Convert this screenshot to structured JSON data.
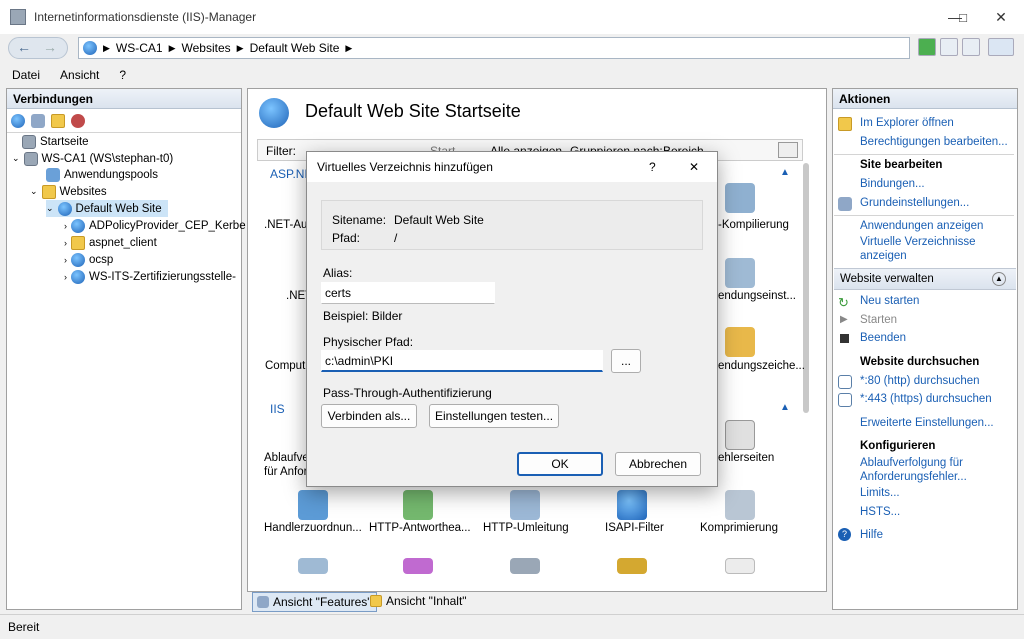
{
  "window": {
    "title": "Internetinformationsdienste (IIS)-Manager"
  },
  "address": {
    "crumbs": [
      "WS-CA1",
      "Websites",
      "Default Web Site"
    ]
  },
  "menu": {
    "items": [
      "Datei",
      "Ansicht",
      "?"
    ]
  },
  "connections": {
    "header": "Verbindungen",
    "tree": [
      {
        "label": "Startseite"
      },
      {
        "label": "WS-CA1 (WS\\stephan-t0)"
      },
      {
        "label": "Anwendungspools"
      },
      {
        "label": "Websites"
      },
      {
        "label": "Default Web Site"
      },
      {
        "label": "ADPolicyProvider_CEP_Kerbe"
      },
      {
        "label": "aspnet_client"
      },
      {
        "label": "ocsp"
      },
      {
        "label": "WS-ITS-Zertifizierungsstelle-"
      }
    ]
  },
  "main": {
    "title": "Default Web Site Startseite",
    "filter_label": "Filter:",
    "start_label": "Start",
    "show_all": "Alle anzeigen",
    "group_by": "Gruppieren nach:",
    "group_value": "Bereich",
    "section_aspnet": "ASP.NE",
    "section_iis": "IIS",
    "features": {
      "net_au": ".NET-Au",
      "kompilierung": "-Kompilierung",
      "net": ".NET",
      "endungseinst": "endungseinst...",
      "comput": "Comput",
      "endungszeiche": "endungszeiche...",
      "ablaufve": "Ablaufve",
      "fuer_anfor": "für Anfor",
      "fehlerseiten": "ehlerseiten",
      "handler": "Handlerzuordnun...",
      "http_antwort": "HTTP-Antworthea...",
      "http_umleitung": "HTTP-Umleitung",
      "isapi": "ISAPI-Filter",
      "komprimierung": "Komprimierung"
    },
    "view_features": "Ansicht \"Features\"",
    "view_content": "Ansicht \"Inhalt\""
  },
  "actions": {
    "header": "Aktionen",
    "explorer": "Im Explorer öffnen",
    "perm": "Berechtigungen bearbeiten...",
    "site_edit": "Site bearbeiten",
    "bindings": "Bindungen...",
    "basic": "Grundeinstellungen...",
    "apps": "Anwendungen anzeigen",
    "vdirs1": "Virtuelle Verzeichnisse",
    "vdirs2": "anzeigen",
    "manage": "Website verwalten",
    "restart": "Neu starten",
    "start": "Starten",
    "stop": "Beenden",
    "browse_h": "Website durchsuchen",
    "browse80": "*:80 (http) durchsuchen",
    "browse443": "*:443 (https) durchsuchen",
    "advanced": "Erweiterte Einstellungen...",
    "configure": "Konfigurieren",
    "trace1": "Ablaufverfolgung für",
    "trace2": "Anforderungsfehler...",
    "limits": "Limits...",
    "hsts": "HSTS...",
    "help": "Hilfe"
  },
  "dialog": {
    "title": "Virtuelles Verzeichnis hinzufügen",
    "help": "?",
    "close": "✕",
    "site_label": "Sitename:",
    "site_value": "Default Web Site",
    "path_label": "Pfad:",
    "path_value": "/",
    "alias_label": "Alias:",
    "alias_value": "certs",
    "example": "Beispiel: Bilder",
    "phys_label": "Physischer Pfad:",
    "phys_value": "c:\\admin\\PKI",
    "browse": "...",
    "passthrough": "Pass-Through-Authentifizierung",
    "connect_as": "Verbinden als...",
    "test": "Einstellungen testen...",
    "ok": "OK",
    "cancel": "Abbrechen"
  },
  "status": {
    "text": "Bereit"
  }
}
